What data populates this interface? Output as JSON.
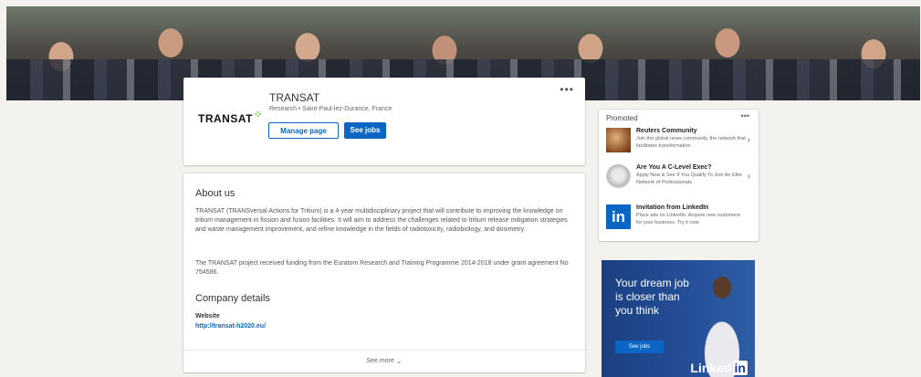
{
  "company": {
    "name": "TRANSAT",
    "logo_text": "TRANSAT",
    "tagline": "Research • Saint-Paul-lez-Durance, France",
    "manage_label": "Manage page",
    "jobs_label": "See jobs",
    "more_label": "•••"
  },
  "about": {
    "title": "About us",
    "paragraph1": "TRANSAT (TRANSversal Actions for Tritium) is a 4-year multidisciplinary project that will contribute to improving the knowledge on tritium management in fission and fusion facilities. It will aim to address the challenges related to tritium release mitigation strategies and waste management improvement, and refine knowledge in the fields of radiotoxicity, radiobiology, and dosimetry.",
    "paragraph2": "The TRANSAT project received funding from the Euratom Research and Training Programme 2014-2018 under grant agreement No 754586.",
    "details_title": "Company details",
    "website_label": "Website",
    "website_url": "http://transat-h2020.eu/",
    "see_more": "See more"
  },
  "promoted": {
    "title": "Promoted",
    "more_label": "•••",
    "ads": [
      {
        "headline": "Reuters Community",
        "body": "Join the global news community, the network that facilitates transformation",
        "icon": "reuters-thumbnail"
      },
      {
        "headline": "Are You A C-Level Exec?",
        "body": "Apply Now & See If You Qualify To Join An Elite Network of Professionals.",
        "icon": "exec-thumbnail"
      },
      {
        "headline": "Invitation from LinkedIn",
        "body": "Place ads on LinkedIn. Acquire new customers for your business. Try it now.",
        "icon": "linkedin-icon"
      }
    ]
  },
  "jobs_ad": {
    "headline": "Your dream job is closer than you think",
    "button": "See jobs",
    "brand_a": "Linked",
    "brand_b": "in"
  },
  "colors": {
    "accent": "#0a66c2",
    "logo_green": "#5db233",
    "ad_blue": "#1b3f82"
  }
}
